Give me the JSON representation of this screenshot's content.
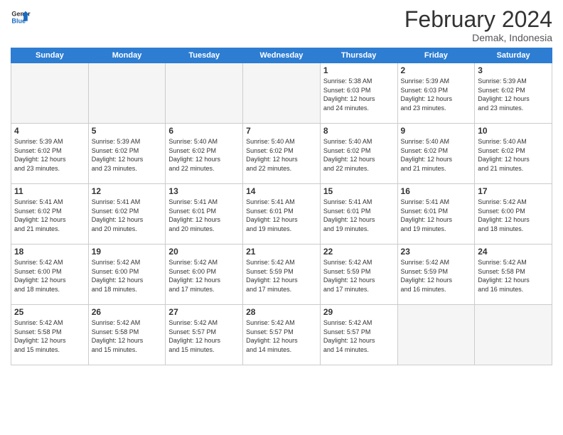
{
  "logo": {
    "line1": "General",
    "line2": "Blue"
  },
  "title": "February 2024",
  "subtitle": "Demak, Indonesia",
  "headers": [
    "Sunday",
    "Monday",
    "Tuesday",
    "Wednesday",
    "Thursday",
    "Friday",
    "Saturday"
  ],
  "weeks": [
    [
      {
        "day": "",
        "info": ""
      },
      {
        "day": "",
        "info": ""
      },
      {
        "day": "",
        "info": ""
      },
      {
        "day": "",
        "info": ""
      },
      {
        "day": "1",
        "info": "Sunrise: 5:38 AM\nSunset: 6:03 PM\nDaylight: 12 hours\nand 24 minutes."
      },
      {
        "day": "2",
        "info": "Sunrise: 5:39 AM\nSunset: 6:03 PM\nDaylight: 12 hours\nand 23 minutes."
      },
      {
        "day": "3",
        "info": "Sunrise: 5:39 AM\nSunset: 6:02 PM\nDaylight: 12 hours\nand 23 minutes."
      }
    ],
    [
      {
        "day": "4",
        "info": "Sunrise: 5:39 AM\nSunset: 6:02 PM\nDaylight: 12 hours\nand 23 minutes."
      },
      {
        "day": "5",
        "info": "Sunrise: 5:39 AM\nSunset: 6:02 PM\nDaylight: 12 hours\nand 23 minutes."
      },
      {
        "day": "6",
        "info": "Sunrise: 5:40 AM\nSunset: 6:02 PM\nDaylight: 12 hours\nand 22 minutes."
      },
      {
        "day": "7",
        "info": "Sunrise: 5:40 AM\nSunset: 6:02 PM\nDaylight: 12 hours\nand 22 minutes."
      },
      {
        "day": "8",
        "info": "Sunrise: 5:40 AM\nSunset: 6:02 PM\nDaylight: 12 hours\nand 22 minutes."
      },
      {
        "day": "9",
        "info": "Sunrise: 5:40 AM\nSunset: 6:02 PM\nDaylight: 12 hours\nand 21 minutes."
      },
      {
        "day": "10",
        "info": "Sunrise: 5:40 AM\nSunset: 6:02 PM\nDaylight: 12 hours\nand 21 minutes."
      }
    ],
    [
      {
        "day": "11",
        "info": "Sunrise: 5:41 AM\nSunset: 6:02 PM\nDaylight: 12 hours\nand 21 minutes."
      },
      {
        "day": "12",
        "info": "Sunrise: 5:41 AM\nSunset: 6:02 PM\nDaylight: 12 hours\nand 20 minutes."
      },
      {
        "day": "13",
        "info": "Sunrise: 5:41 AM\nSunset: 6:01 PM\nDaylight: 12 hours\nand 20 minutes."
      },
      {
        "day": "14",
        "info": "Sunrise: 5:41 AM\nSunset: 6:01 PM\nDaylight: 12 hours\nand 19 minutes."
      },
      {
        "day": "15",
        "info": "Sunrise: 5:41 AM\nSunset: 6:01 PM\nDaylight: 12 hours\nand 19 minutes."
      },
      {
        "day": "16",
        "info": "Sunrise: 5:41 AM\nSunset: 6:01 PM\nDaylight: 12 hours\nand 19 minutes."
      },
      {
        "day": "17",
        "info": "Sunrise: 5:42 AM\nSunset: 6:00 PM\nDaylight: 12 hours\nand 18 minutes."
      }
    ],
    [
      {
        "day": "18",
        "info": "Sunrise: 5:42 AM\nSunset: 6:00 PM\nDaylight: 12 hours\nand 18 minutes."
      },
      {
        "day": "19",
        "info": "Sunrise: 5:42 AM\nSunset: 6:00 PM\nDaylight: 12 hours\nand 18 minutes."
      },
      {
        "day": "20",
        "info": "Sunrise: 5:42 AM\nSunset: 6:00 PM\nDaylight: 12 hours\nand 17 minutes."
      },
      {
        "day": "21",
        "info": "Sunrise: 5:42 AM\nSunset: 5:59 PM\nDaylight: 12 hours\nand 17 minutes."
      },
      {
        "day": "22",
        "info": "Sunrise: 5:42 AM\nSunset: 5:59 PM\nDaylight: 12 hours\nand 17 minutes."
      },
      {
        "day": "23",
        "info": "Sunrise: 5:42 AM\nSunset: 5:59 PM\nDaylight: 12 hours\nand 16 minutes."
      },
      {
        "day": "24",
        "info": "Sunrise: 5:42 AM\nSunset: 5:58 PM\nDaylight: 12 hours\nand 16 minutes."
      }
    ],
    [
      {
        "day": "25",
        "info": "Sunrise: 5:42 AM\nSunset: 5:58 PM\nDaylight: 12 hours\nand 15 minutes."
      },
      {
        "day": "26",
        "info": "Sunrise: 5:42 AM\nSunset: 5:58 PM\nDaylight: 12 hours\nand 15 minutes."
      },
      {
        "day": "27",
        "info": "Sunrise: 5:42 AM\nSunset: 5:57 PM\nDaylight: 12 hours\nand 15 minutes."
      },
      {
        "day": "28",
        "info": "Sunrise: 5:42 AM\nSunset: 5:57 PM\nDaylight: 12 hours\nand 14 minutes."
      },
      {
        "day": "29",
        "info": "Sunrise: 5:42 AM\nSunset: 5:57 PM\nDaylight: 12 hours\nand 14 minutes."
      },
      {
        "day": "",
        "info": ""
      },
      {
        "day": "",
        "info": ""
      }
    ]
  ]
}
